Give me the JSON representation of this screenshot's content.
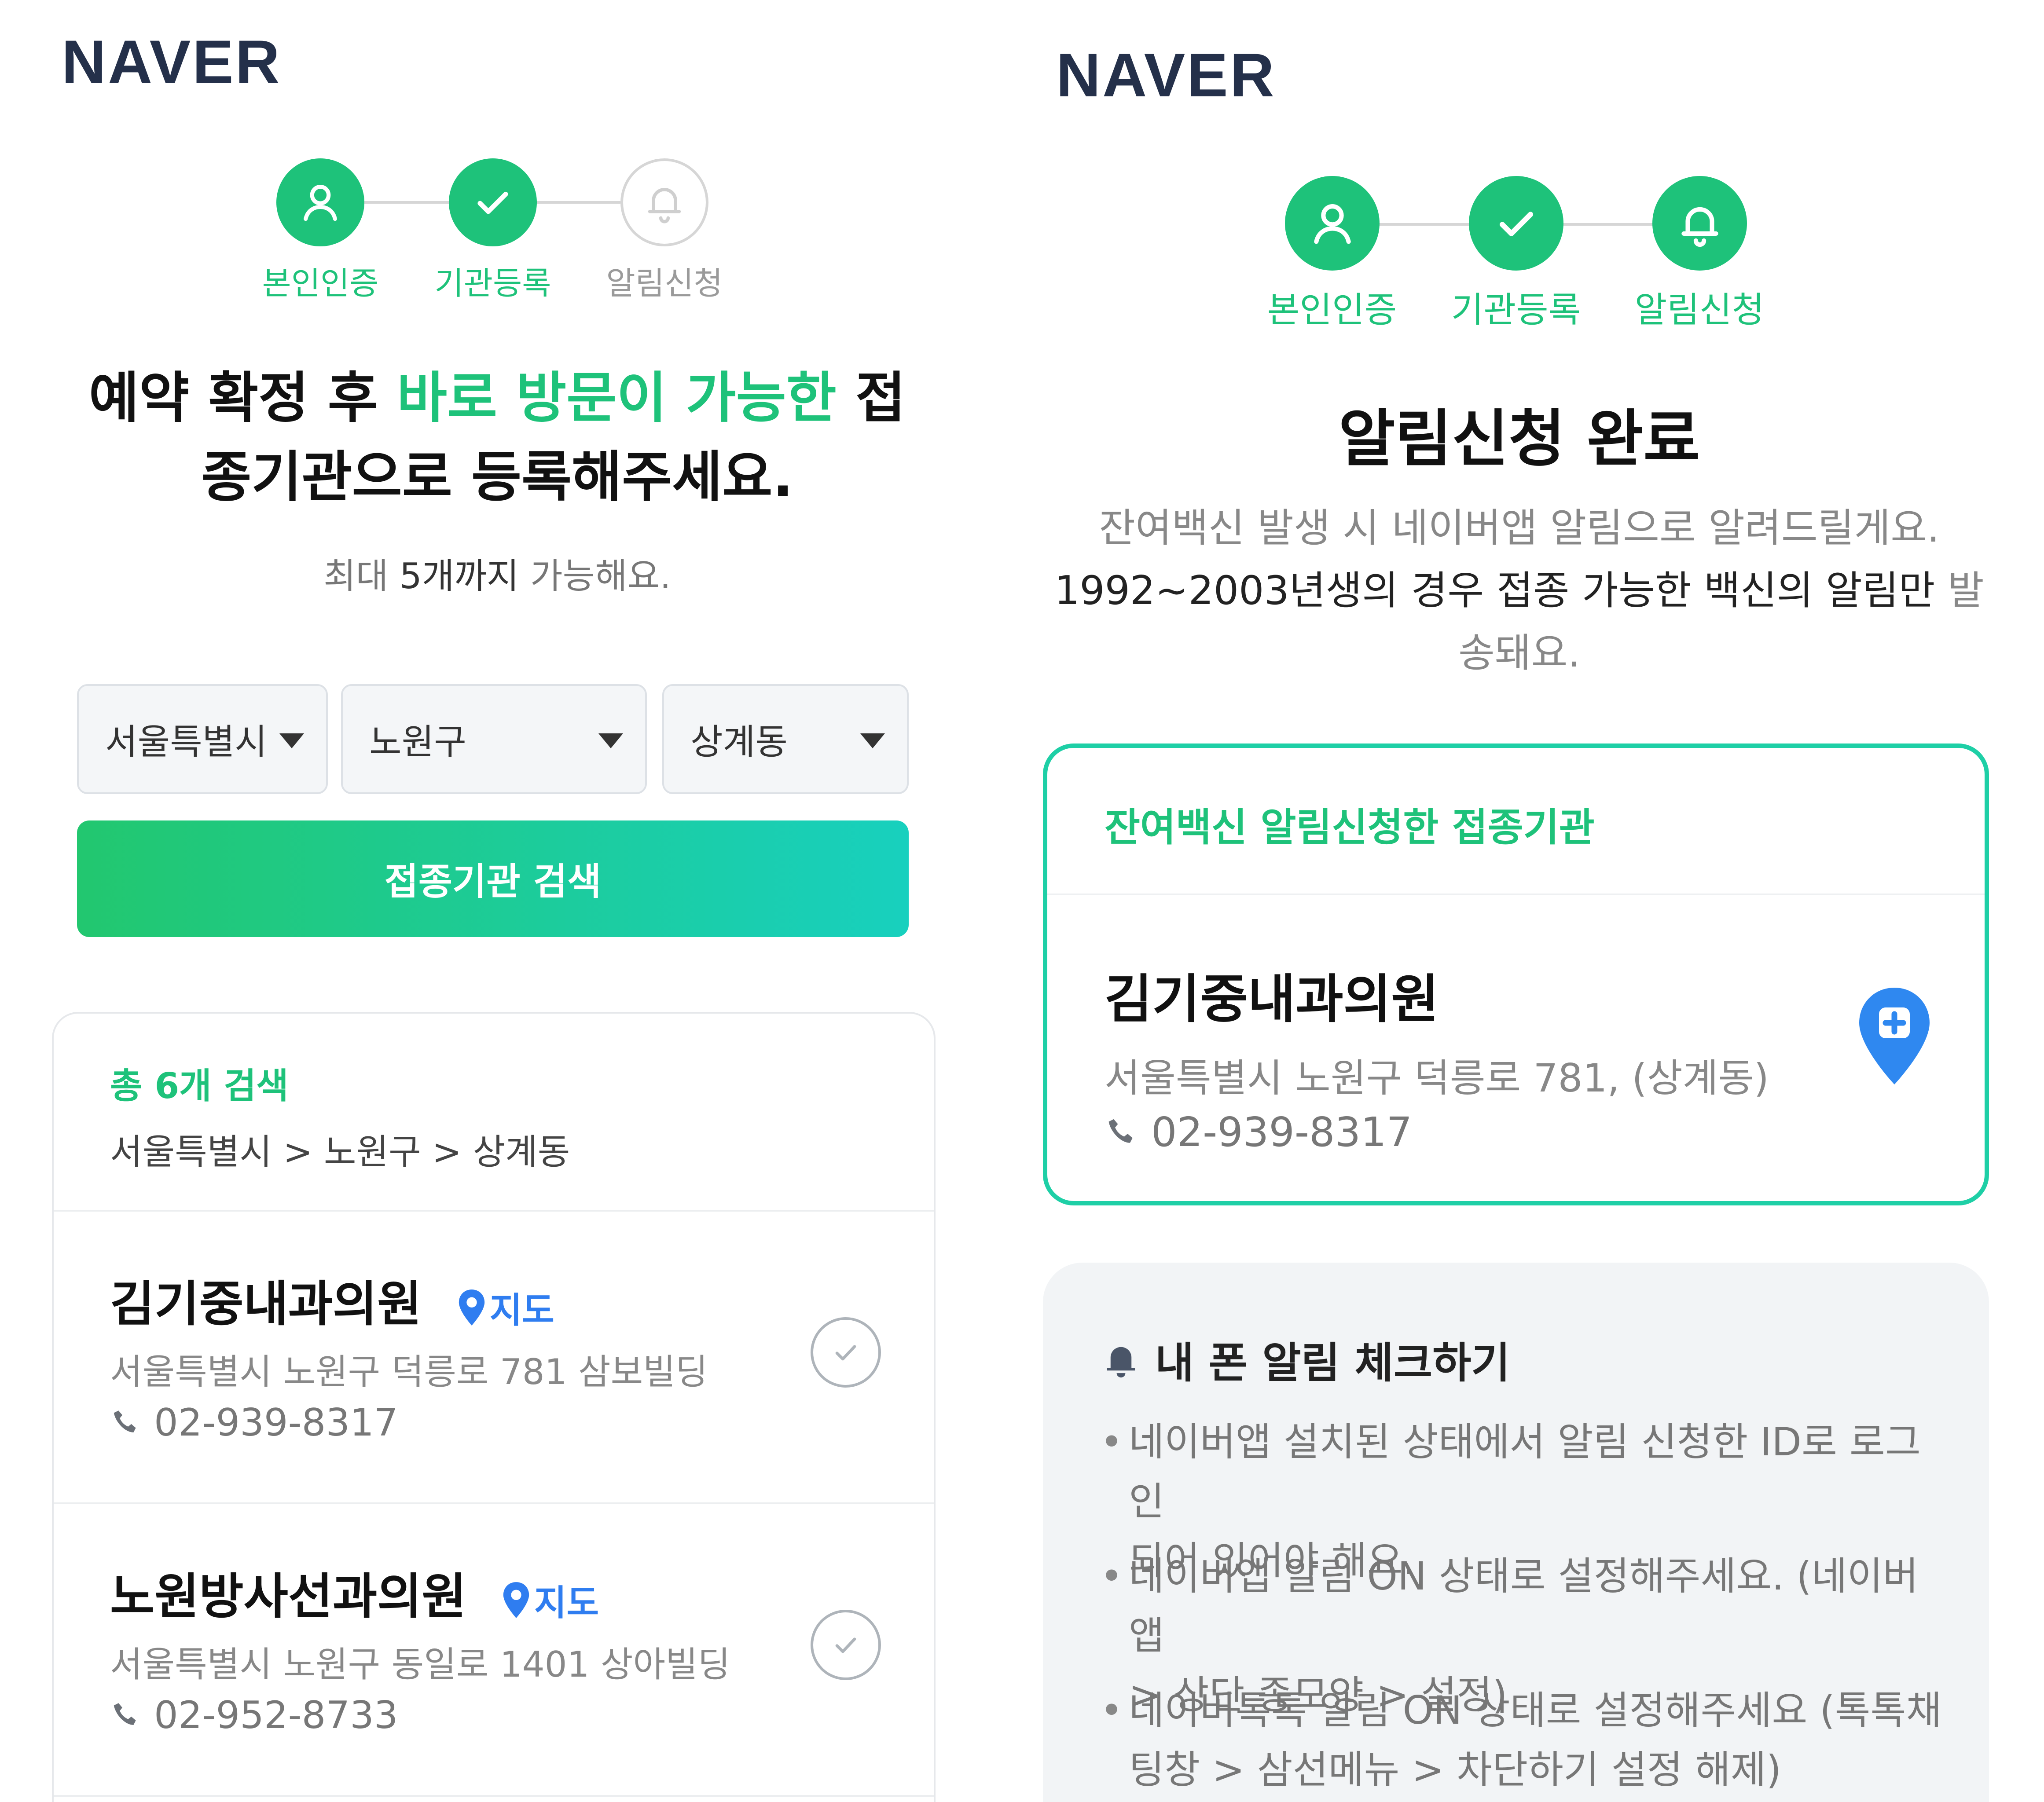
{
  "left": {
    "logo": "NAVER",
    "steps": [
      {
        "label": "본인인증",
        "icon": "person-icon",
        "active": true
      },
      {
        "label": "기관등록",
        "icon": "check-icon",
        "active": true
      },
      {
        "label": "알림신청",
        "icon": "bell-icon",
        "active": false
      }
    ],
    "headline": {
      "part1": "예약 확정 후 ",
      "highlight": "바로 방문이 가능한",
      "part2": " 접",
      "line2": "종기관으로 등록해주세요."
    },
    "subtext": {
      "pre": "최대 ",
      "strong": "5개까지",
      "post": " 가능해요."
    },
    "selects": {
      "city": "서울특별시",
      "district": "노원구",
      "dong": "상계동"
    },
    "search_button": "접종기관 검색",
    "results": {
      "count": "총 6개 검색",
      "path": "서울특별시 > 노원구 > 상계동",
      "map_label": "지도",
      "items": [
        {
          "name": "김기중내과의원",
          "address": "서울특별시 노원구 덕릉로 781 삼보빌딩",
          "phone": "02-939-8317"
        },
        {
          "name": "노원방사선과의원",
          "address": "서울특별시 노원구 동일로 1401 상아빌딩",
          "phone": "02-952-8733"
        }
      ]
    }
  },
  "right": {
    "logo": "NAVER",
    "steps": [
      {
        "label": "본인인증",
        "icon": "person-icon",
        "active": true
      },
      {
        "label": "기관등록",
        "icon": "check-icon",
        "active": true
      },
      {
        "label": "알림신청",
        "icon": "bell-icon",
        "active": true
      }
    ],
    "title": "알림신청 완료",
    "desc": {
      "line1": "잔여백신 발생 시 네이버앱 알림으로 알려드릴게요.",
      "line2_dark": "1992~2003년생의 경우 접종 가능한 백신의 알림만",
      "line2_rest": " 발",
      "line3": "송돼요."
    },
    "card": {
      "title": "잔여백신 알림신청한 접종기관",
      "name": "김기중내과의원",
      "address": "서울특별시 노원구 덕릉로 781, (상계동)",
      "phone": "02-939-8317"
    },
    "tips": {
      "title": "내 폰 알림 체크하기",
      "items": [
        {
          "line1": "네이버앱 설치된 상태에서 알림 신청한 ID로 로그인",
          "line2": "되어 있어야 해요."
        },
        {
          "line1": "네이버앱 알림 ON 상태로 설정해주세요. (네이버앱",
          "line2": "> 상단 종모양 > 설정)"
        },
        {
          "line1": "네이버톡톡 알림 ON 상태로 설정해주세요 (톡톡채",
          "line2": "팅창 > 삼선메뉴 > 차단하기 설정 해제)"
        }
      ]
    }
  },
  "colors": {
    "accent": "#1ec27a",
    "teal": "#18d0be",
    "link": "#2f7df0",
    "logo": "#24304a"
  }
}
